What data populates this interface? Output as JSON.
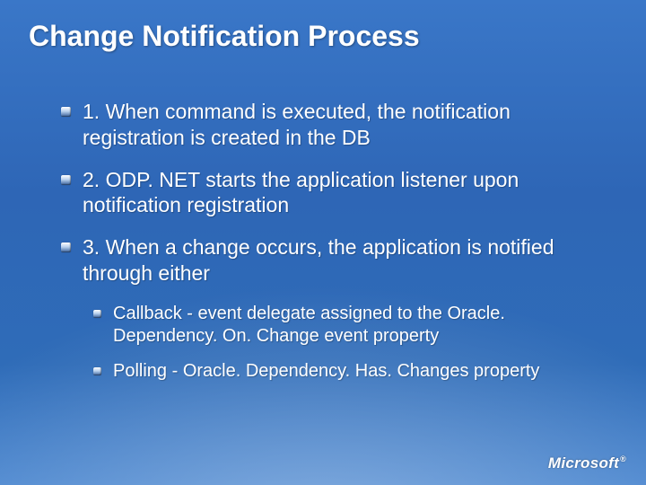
{
  "title": "Change Notification Process",
  "bullets": [
    {
      "text": "1. When command is executed, the notification registration is created in the DB"
    },
    {
      "text": "2. ODP. NET starts the application listener upon notification registration"
    },
    {
      "text": "3. When a change occurs, the application is notified through either",
      "sub": [
        {
          "text": "Callback -  event delegate assigned to the Oracle. Dependency. On. Change event property"
        },
        {
          "text": "Polling - Oracle. Dependency. Has. Changes property"
        }
      ]
    }
  ],
  "logo": {
    "text": "Microsoft",
    "reg": "®"
  }
}
